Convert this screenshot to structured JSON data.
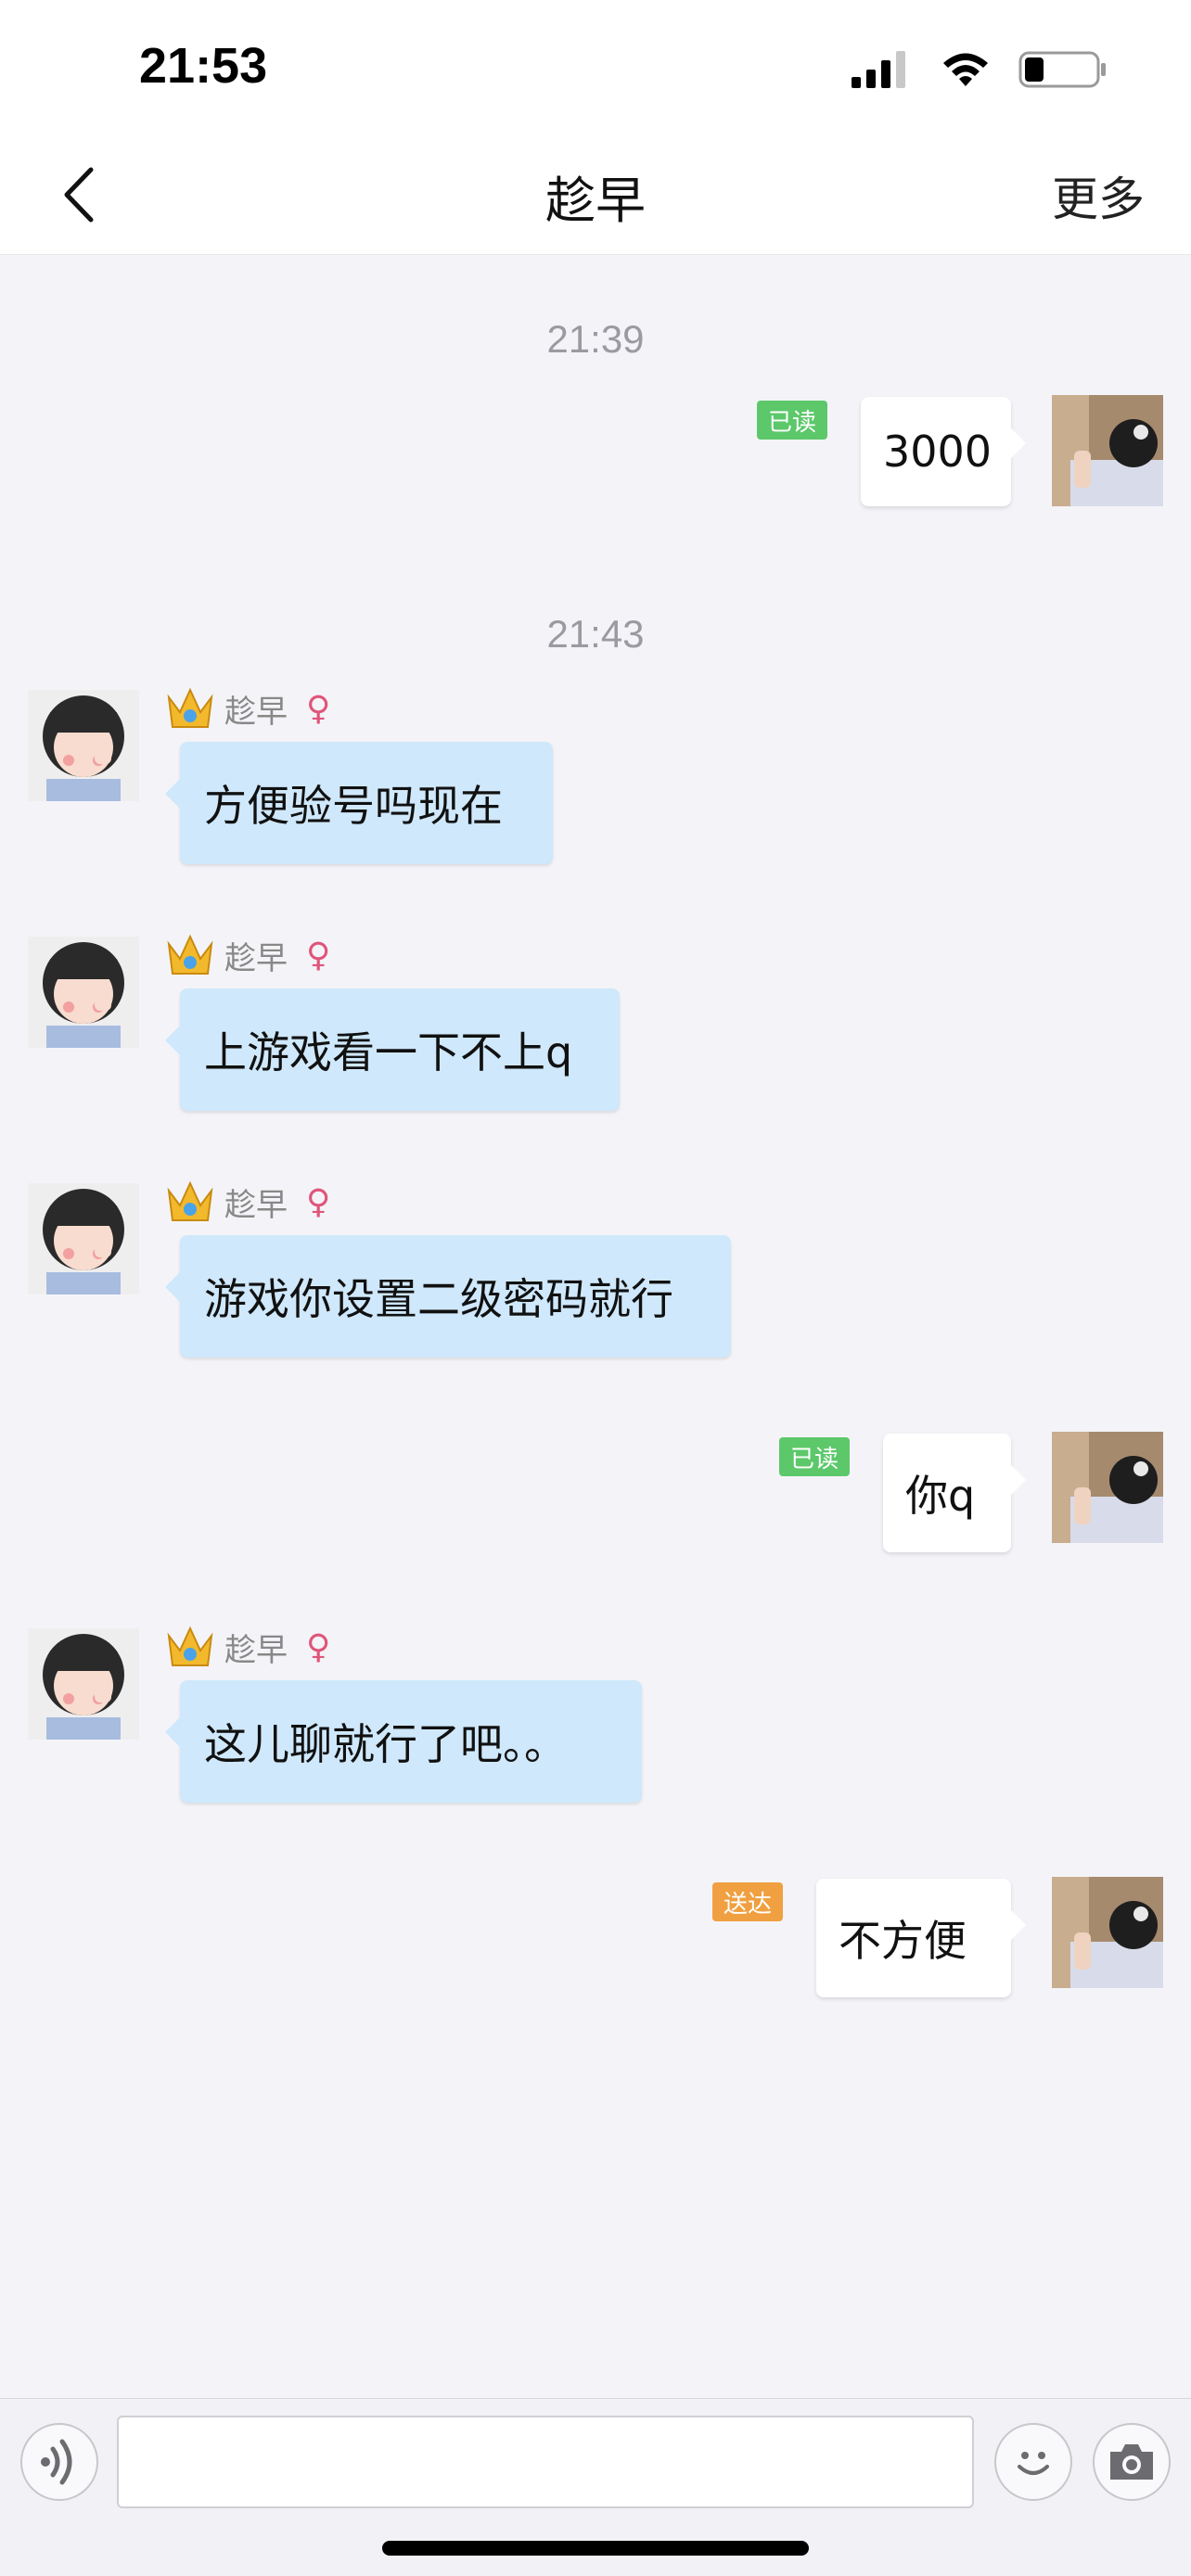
{
  "status_bar": {
    "time": "21:53"
  },
  "nav": {
    "title": "趁早",
    "more_label": "更多"
  },
  "chat": {
    "timestamps": [
      "21:39",
      "21:43"
    ],
    "messages": [
      {
        "direction": "outgoing",
        "text": "3000",
        "badge": "已读"
      },
      {
        "direction": "incoming",
        "sender": "趁早",
        "text": "方便验号吗现在"
      },
      {
        "direction": "incoming",
        "sender": "趁早",
        "text": "上游戏看一下不上q"
      },
      {
        "direction": "incoming",
        "sender": "趁早",
        "text": "游戏你设置二级密码就行"
      },
      {
        "direction": "outgoing",
        "text": "你q",
        "badge": "已读"
      },
      {
        "direction": "incoming",
        "sender": "趁早",
        "text": "这儿聊就行了吧。。"
      },
      {
        "direction": "outgoing",
        "text": "不方便",
        "badge": "送达"
      }
    ],
    "female_symbol": "♀"
  },
  "input": {
    "value": "",
    "placeholder": ""
  },
  "colors": {
    "incoming_bubble": "#cfe8fb",
    "outgoing_bubble": "#ffffff",
    "badge_read": "#5cc86a",
    "badge_delivered": "#f0a040",
    "background": "#f4f4f8"
  },
  "icons": {
    "voice": "voice-icon",
    "emoji": "emoji-icon",
    "camera": "camera-icon",
    "back": "back-icon",
    "crown": "crown-icon",
    "female": "female-icon"
  }
}
